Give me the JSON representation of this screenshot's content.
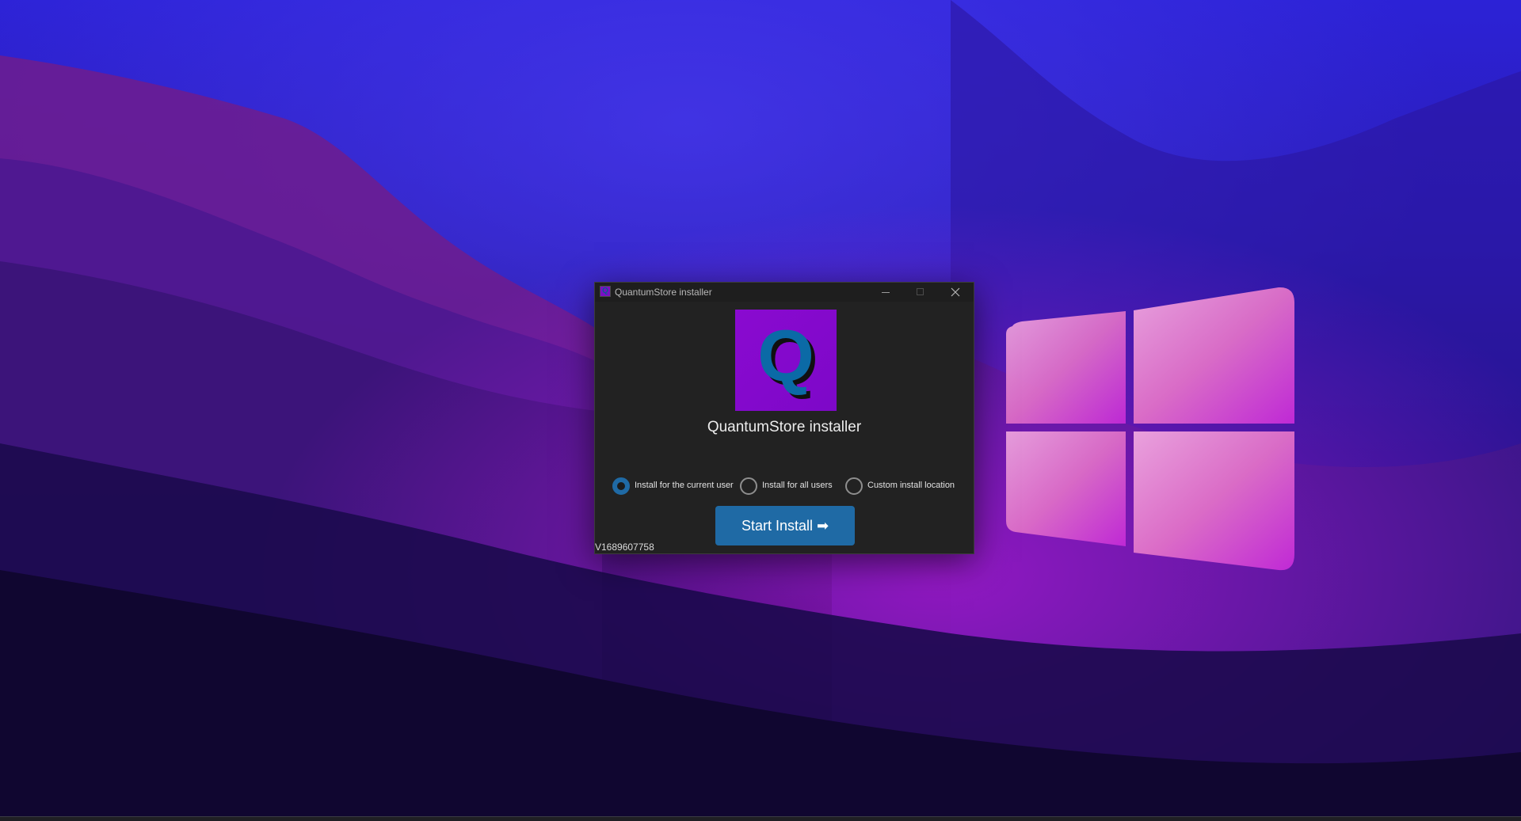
{
  "window": {
    "title": "QuantumStore installer",
    "icon": "app-icon-q"
  },
  "logo": {
    "letter": "Q",
    "background_color": "#7d08c8",
    "letter_color": "#0b6aa6"
  },
  "installer": {
    "heading": "QuantumStore installer",
    "options": [
      {
        "label": "Install for the current user",
        "selected": true
      },
      {
        "label": "Install for all users",
        "selected": false
      },
      {
        "label": "Custom install location",
        "selected": false
      }
    ],
    "start_button_label": "Start Install ➡",
    "version": "V1689607758"
  },
  "colors": {
    "accent": "#1f6aa5",
    "window_bg": "#222222",
    "titlebar_bg": "#1e1e1e"
  }
}
